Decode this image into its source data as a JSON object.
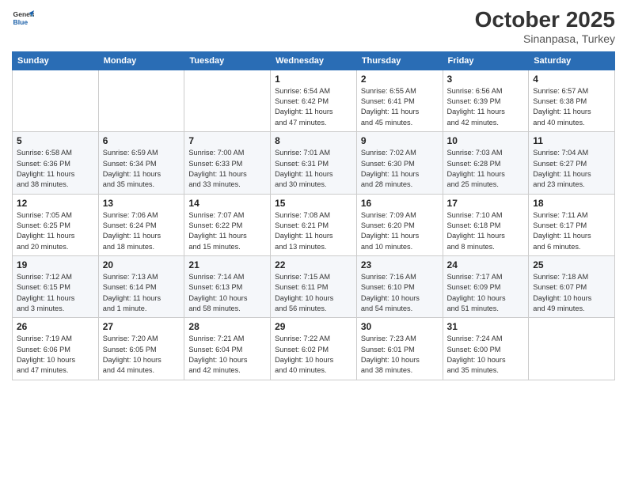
{
  "header": {
    "logo_line1": "General",
    "logo_line2": "Blue",
    "month": "October 2025",
    "location": "Sinanpasa, Turkey"
  },
  "days_of_week": [
    "Sunday",
    "Monday",
    "Tuesday",
    "Wednesday",
    "Thursday",
    "Friday",
    "Saturday"
  ],
  "weeks": [
    [
      {
        "day": "",
        "info": ""
      },
      {
        "day": "",
        "info": ""
      },
      {
        "day": "",
        "info": ""
      },
      {
        "day": "1",
        "info": "Sunrise: 6:54 AM\nSunset: 6:42 PM\nDaylight: 11 hours\nand 47 minutes."
      },
      {
        "day": "2",
        "info": "Sunrise: 6:55 AM\nSunset: 6:41 PM\nDaylight: 11 hours\nand 45 minutes."
      },
      {
        "day": "3",
        "info": "Sunrise: 6:56 AM\nSunset: 6:39 PM\nDaylight: 11 hours\nand 42 minutes."
      },
      {
        "day": "4",
        "info": "Sunrise: 6:57 AM\nSunset: 6:38 PM\nDaylight: 11 hours\nand 40 minutes."
      }
    ],
    [
      {
        "day": "5",
        "info": "Sunrise: 6:58 AM\nSunset: 6:36 PM\nDaylight: 11 hours\nand 38 minutes."
      },
      {
        "day": "6",
        "info": "Sunrise: 6:59 AM\nSunset: 6:34 PM\nDaylight: 11 hours\nand 35 minutes."
      },
      {
        "day": "7",
        "info": "Sunrise: 7:00 AM\nSunset: 6:33 PM\nDaylight: 11 hours\nand 33 minutes."
      },
      {
        "day": "8",
        "info": "Sunrise: 7:01 AM\nSunset: 6:31 PM\nDaylight: 11 hours\nand 30 minutes."
      },
      {
        "day": "9",
        "info": "Sunrise: 7:02 AM\nSunset: 6:30 PM\nDaylight: 11 hours\nand 28 minutes."
      },
      {
        "day": "10",
        "info": "Sunrise: 7:03 AM\nSunset: 6:28 PM\nDaylight: 11 hours\nand 25 minutes."
      },
      {
        "day": "11",
        "info": "Sunrise: 7:04 AM\nSunset: 6:27 PM\nDaylight: 11 hours\nand 23 minutes."
      }
    ],
    [
      {
        "day": "12",
        "info": "Sunrise: 7:05 AM\nSunset: 6:25 PM\nDaylight: 11 hours\nand 20 minutes."
      },
      {
        "day": "13",
        "info": "Sunrise: 7:06 AM\nSunset: 6:24 PM\nDaylight: 11 hours\nand 18 minutes."
      },
      {
        "day": "14",
        "info": "Sunrise: 7:07 AM\nSunset: 6:22 PM\nDaylight: 11 hours\nand 15 minutes."
      },
      {
        "day": "15",
        "info": "Sunrise: 7:08 AM\nSunset: 6:21 PM\nDaylight: 11 hours\nand 13 minutes."
      },
      {
        "day": "16",
        "info": "Sunrise: 7:09 AM\nSunset: 6:20 PM\nDaylight: 11 hours\nand 10 minutes."
      },
      {
        "day": "17",
        "info": "Sunrise: 7:10 AM\nSunset: 6:18 PM\nDaylight: 11 hours\nand 8 minutes."
      },
      {
        "day": "18",
        "info": "Sunrise: 7:11 AM\nSunset: 6:17 PM\nDaylight: 11 hours\nand 6 minutes."
      }
    ],
    [
      {
        "day": "19",
        "info": "Sunrise: 7:12 AM\nSunset: 6:15 PM\nDaylight: 11 hours\nand 3 minutes."
      },
      {
        "day": "20",
        "info": "Sunrise: 7:13 AM\nSunset: 6:14 PM\nDaylight: 11 hours\nand 1 minute."
      },
      {
        "day": "21",
        "info": "Sunrise: 7:14 AM\nSunset: 6:13 PM\nDaylight: 10 hours\nand 58 minutes."
      },
      {
        "day": "22",
        "info": "Sunrise: 7:15 AM\nSunset: 6:11 PM\nDaylight: 10 hours\nand 56 minutes."
      },
      {
        "day": "23",
        "info": "Sunrise: 7:16 AM\nSunset: 6:10 PM\nDaylight: 10 hours\nand 54 minutes."
      },
      {
        "day": "24",
        "info": "Sunrise: 7:17 AM\nSunset: 6:09 PM\nDaylight: 10 hours\nand 51 minutes."
      },
      {
        "day": "25",
        "info": "Sunrise: 7:18 AM\nSunset: 6:07 PM\nDaylight: 10 hours\nand 49 minutes."
      }
    ],
    [
      {
        "day": "26",
        "info": "Sunrise: 7:19 AM\nSunset: 6:06 PM\nDaylight: 10 hours\nand 47 minutes."
      },
      {
        "day": "27",
        "info": "Sunrise: 7:20 AM\nSunset: 6:05 PM\nDaylight: 10 hours\nand 44 minutes."
      },
      {
        "day": "28",
        "info": "Sunrise: 7:21 AM\nSunset: 6:04 PM\nDaylight: 10 hours\nand 42 minutes."
      },
      {
        "day": "29",
        "info": "Sunrise: 7:22 AM\nSunset: 6:02 PM\nDaylight: 10 hours\nand 40 minutes."
      },
      {
        "day": "30",
        "info": "Sunrise: 7:23 AM\nSunset: 6:01 PM\nDaylight: 10 hours\nand 38 minutes."
      },
      {
        "day": "31",
        "info": "Sunrise: 7:24 AM\nSunset: 6:00 PM\nDaylight: 10 hours\nand 35 minutes."
      },
      {
        "day": "",
        "info": ""
      }
    ]
  ]
}
